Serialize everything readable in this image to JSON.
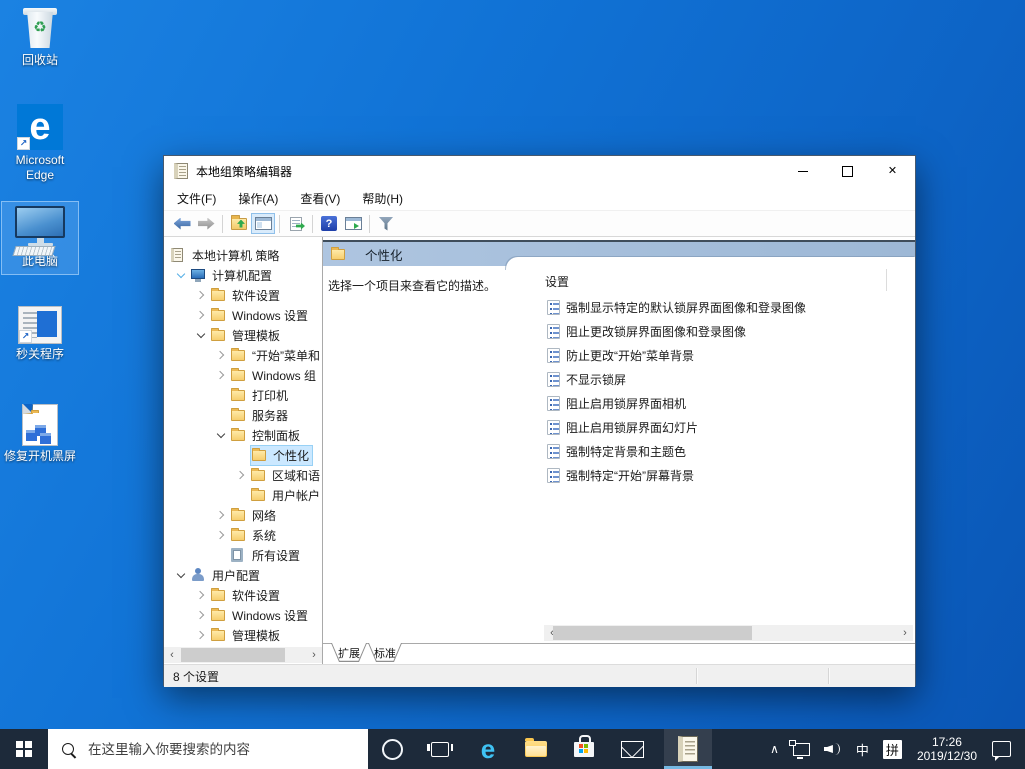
{
  "desktop": {
    "icons": [
      {
        "label": "回收站"
      },
      {
        "label": "Microsoft Edge"
      },
      {
        "label": "此电脑",
        "selected": true
      },
      {
        "label": "秒关程序"
      },
      {
        "label": "修复开机黑屏"
      }
    ]
  },
  "window": {
    "title": "本地组策略编辑器",
    "controls": [
      "minimize",
      "maximize",
      "close"
    ],
    "menu": {
      "file": "文件(F)",
      "action": "操作(A)",
      "view": "查看(V)",
      "help": "帮助(H)"
    },
    "toolbar_buttons": [
      "back",
      "forward",
      "up-one-level",
      "show-console-tree",
      "export-list",
      "help",
      "show-action-pane",
      "filter"
    ],
    "tree": {
      "items": [
        {
          "label": "本地计算机 策略"
        },
        {
          "label": "计算机配置"
        },
        {
          "label": "软件设置"
        },
        {
          "label": "Windows 设置"
        },
        {
          "label": "管理模板"
        },
        {
          "label": "“开始”菜单和"
        },
        {
          "label": "Windows 组"
        },
        {
          "label": "打印机"
        },
        {
          "label": "服务器"
        },
        {
          "label": "控制面板"
        },
        {
          "label": "个性化"
        },
        {
          "label": "区域和语"
        },
        {
          "label": "用户帐户"
        },
        {
          "label": "网络"
        },
        {
          "label": "系统"
        },
        {
          "label": "所有设置"
        },
        {
          "label": "用户配置"
        },
        {
          "label": "软件设置"
        },
        {
          "label": "Windows 设置"
        },
        {
          "label": "管理模板"
        }
      ]
    },
    "panel": {
      "header": "个性化",
      "description": "选择一个项目来查看它的描述。",
      "column": "设置",
      "settings": [
        {
          "label": "强制显示特定的默认锁屏界面图像和登录图像"
        },
        {
          "label": "阻止更改锁屏界面图像和登录图像"
        },
        {
          "label": "防止更改“开始”菜单背景"
        },
        {
          "label": "不显示锁屏"
        },
        {
          "label": "阻止启用锁屏界面相机"
        },
        {
          "label": "阻止启用锁屏界面幻灯片"
        },
        {
          "label": "强制特定背景和主题色"
        },
        {
          "label": "强制特定“开始”屏幕背景"
        }
      ]
    },
    "tabs": {
      "extended": "扩展",
      "standard": "标准"
    },
    "status": {
      "text": "8 个设置"
    }
  },
  "taskbar": {
    "search_placeholder": "在这里输入你要搜索的内容",
    "apps": [
      "start",
      "search",
      "cortana",
      "task-view",
      "edge",
      "file-explorer",
      "store",
      "mail",
      "group-policy-editor"
    ],
    "tray": {
      "ime_lang": "中",
      "ime_mode": "拼",
      "time": "17:26",
      "date": "2019/12/30"
    }
  },
  "icons": {
    "glyphs": {
      "scroll_left": "‹",
      "scroll_right": "›",
      "tray_chevron": "∧",
      "close": "✕",
      "help_q": "?",
      "edge_e": "e",
      "shortcut_arrow": "↗",
      "recycle": "♻︎"
    }
  },
  "colors": {
    "desktop_blue": "#0f6cc4",
    "taskbar": "#1d2a3a",
    "panel_band": "#a2bcd9",
    "tree_selection": "#cbe8ff",
    "accent": "#0078d7"
  }
}
